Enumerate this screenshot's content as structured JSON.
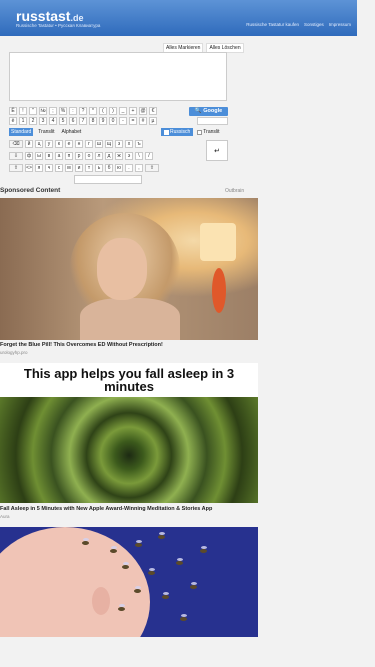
{
  "header": {
    "logo": "russtast",
    "logo_tld": ".de",
    "tagline": "Russische Tastatur • Русская Клавиатура",
    "nav": [
      "Russische Tastatur kaufen",
      "Sonstiges",
      "Impressum"
    ]
  },
  "editor": {
    "mark_all": "Alles Markieren",
    "clear_all": "Alles Löschen",
    "text": ""
  },
  "keyboard": {
    "row1": [
      "Ё",
      "!",
      "\"",
      "№",
      ";",
      "%",
      ":",
      "?",
      "*",
      "(",
      ")",
      "_",
      "+",
      "@",
      "€"
    ],
    "row2": [
      "ё",
      "1",
      "2",
      "3",
      "4",
      "5",
      "6",
      "7",
      "8",
      "9",
      "0",
      "-",
      "=",
      "#",
      "µ"
    ],
    "row3": [
      "⌫",
      "й",
      "ц",
      "у",
      "к",
      "е",
      "н",
      "г",
      "ш",
      "щ",
      "з",
      "х",
      "ъ"
    ],
    "row4": [
      "⇩",
      "ф",
      "ы",
      "в",
      "а",
      "п",
      "р",
      "о",
      "л",
      "д",
      "ж",
      "э",
      "\\",
      "/"
    ],
    "row5": [
      "⇧",
      "<>",
      "я",
      "ч",
      "с",
      "м",
      "и",
      "т",
      "ь",
      "б",
      "ю",
      ".",
      ",",
      "⇧"
    ],
    "google_label": "Google",
    "enter_symbol": "↵",
    "modes": [
      "Standard",
      "Translit",
      "Alphabet"
    ],
    "active_mode": "Standard",
    "lang_russian": "Russisch",
    "lang_translit": "Translit"
  },
  "sponsored": {
    "title": "Sponsored Content",
    "provider": "Outbrain",
    "ads": [
      {
        "title": "Forget the Blue Pill! This Overcomes ED Without Prescription!",
        "source": "urologyhp.pro"
      },
      {
        "title": "Fall Asleep in 5 Minutes with New Apple Award-Winning Meditation & Stories App",
        "source": "Aura",
        "headline": "This app helps you fall asleep in 3 minutes"
      },
      {
        "title": "",
        "source": ""
      }
    ]
  },
  "colors": {
    "header_blue": "#2f6bbc",
    "accent_blue": "#4c8ed9"
  }
}
